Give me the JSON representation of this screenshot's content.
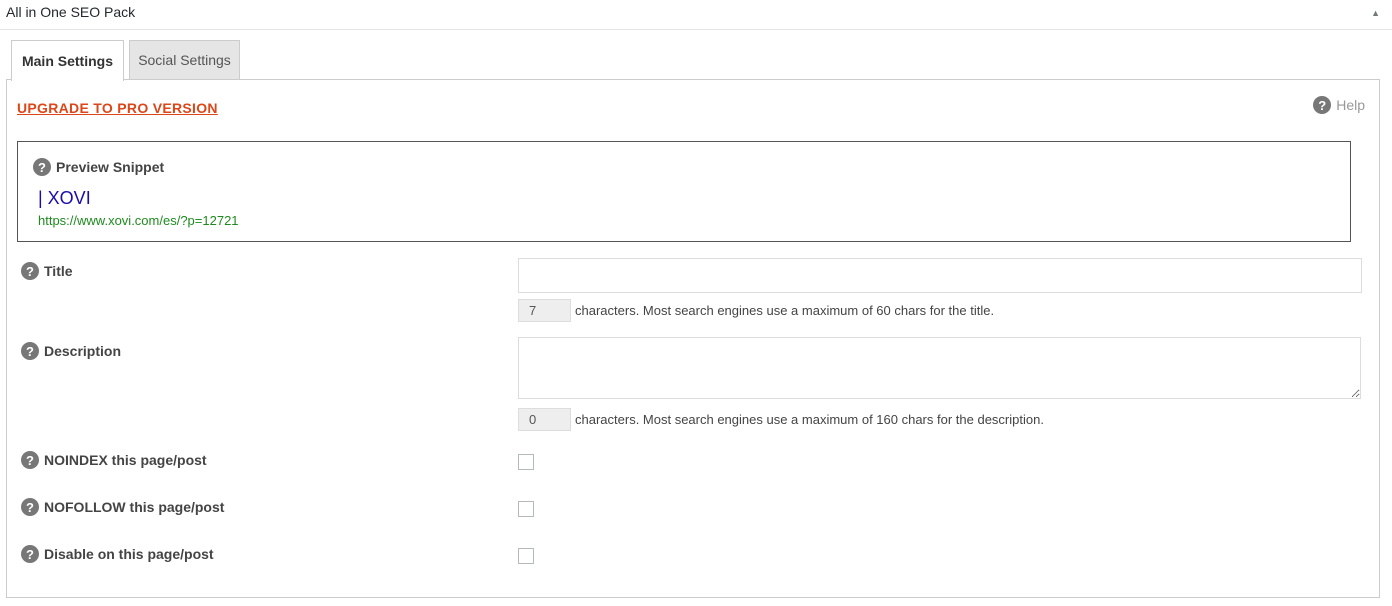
{
  "header": {
    "title": "All in One SEO Pack",
    "toggle_glyph": "▲"
  },
  "tabs": [
    {
      "label": "Main Settings",
      "active": true
    },
    {
      "label": "Social Settings",
      "active": false
    }
  ],
  "upgrade_link": "UPGRADE TO PRO VERSION",
  "help": {
    "label": "Help",
    "icon": "question-circle-icon"
  },
  "preview": {
    "heading": "Preview Snippet",
    "title": "| XOVI",
    "url": "https://www.xovi.com/es/?p=12721"
  },
  "fields": {
    "title": {
      "label": "Title",
      "value": "",
      "count": "7",
      "hint": "characters. Most search engines use a maximum of 60 chars for the title."
    },
    "description": {
      "label": "Description",
      "value": "",
      "count": "0",
      "hint": "characters. Most search engines use a maximum of 160 chars for the description."
    },
    "noindex": {
      "label": "NOINDEX this page/post",
      "checked": false
    },
    "nofollow": {
      "label": "NOFOLLOW this page/post",
      "checked": false
    },
    "disable": {
      "label": "Disable on this page/post",
      "checked": false
    }
  },
  "help_icon_glyph": "?",
  "colors": {
    "upgrade": "#dc4618",
    "snippet_title": "#1a0dab",
    "snippet_url": "#1e8b1e",
    "help_icon_bg": "#777777"
  }
}
